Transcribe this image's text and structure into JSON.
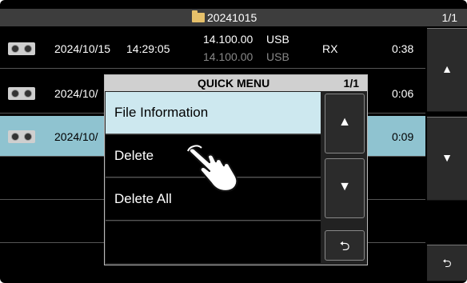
{
  "title_bar": {
    "folder_icon": "folder-icon",
    "folder_name": "20241015",
    "page": "1/1"
  },
  "recordings": [
    {
      "date": "2024/10/15",
      "time": "14:29:05",
      "freq_top": "14.100.00",
      "mode_top": "USB",
      "freq_bottom": "14.100.00",
      "mode_bottom": "USB",
      "type": "RX",
      "duration": "0:38"
    },
    {
      "date": "2024/10/",
      "duration": "0:06"
    },
    {
      "date": "2024/10/",
      "duration": "0:09",
      "selected": true
    }
  ],
  "side_buttons": {
    "up": "▲",
    "down": "▼",
    "back": "⮌"
  },
  "quick_menu": {
    "title": "QUICK MENU",
    "page": "1/1",
    "items": [
      "File Information",
      "Delete",
      "Delete All"
    ],
    "selected_item": "File Information",
    "buttons": {
      "up": "▲",
      "down": "▼",
      "back": "⮌"
    }
  },
  "colors": {
    "selected_row": "#8fc3d0",
    "selected_menu_item": "#cde8ef",
    "title_bar": "#3d3d3d"
  },
  "pointer_icon": "hand-pointer-icon"
}
